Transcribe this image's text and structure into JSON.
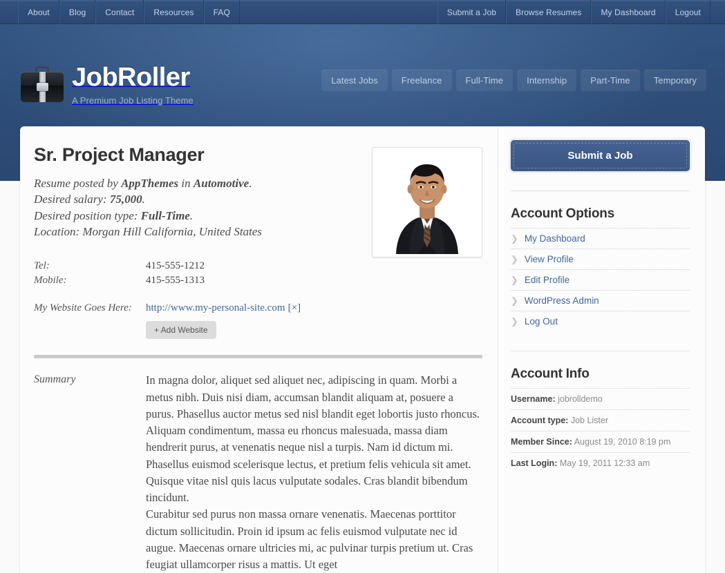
{
  "topbar": {
    "left_items": [
      {
        "label": "About"
      },
      {
        "label": "Blog"
      },
      {
        "label": "Contact"
      },
      {
        "label": "Resources"
      },
      {
        "label": "FAQ"
      }
    ],
    "right_items": [
      {
        "label": "Submit a Job"
      },
      {
        "label": "Browse Resumes"
      },
      {
        "label": "My Dashboard"
      },
      {
        "label": "Logout"
      }
    ]
  },
  "header": {
    "logo_icon": "briefcase-icon",
    "title": "JobRoller",
    "tagline": "A Premium Job Listing Theme",
    "categories": [
      {
        "label": "Latest Jobs"
      },
      {
        "label": "Freelance"
      },
      {
        "label": "Full-Time"
      },
      {
        "label": "Internship"
      },
      {
        "label": "Part-Time"
      },
      {
        "label": "Temporary"
      }
    ]
  },
  "resume": {
    "title": "Sr. Project Manager",
    "posted_prefix": "Resume posted by ",
    "posted_author": "AppThemes",
    "posted_middle": " in ",
    "posted_category": "Automotive",
    "posted_suffix": ".",
    "salary_label": "Desired salary: ",
    "salary_value": "75,000",
    "salary_suffix": ".",
    "position_label": "Desired position type: ",
    "position_value": "Full-Time",
    "position_suffix": ".",
    "location_line": "Location: Morgan Hill California, United States",
    "photo_alt": "applicant-photo",
    "contacts": [
      {
        "label": "Tel:",
        "value": "415-555-1212"
      },
      {
        "label": "Mobile:",
        "value": "415-555-1313"
      }
    ],
    "website_label": "My Website Goes Here:",
    "website_url": "http://www.my-personal-site.com",
    "website_remove": "[×]",
    "add_website_label": "+ Add Website",
    "summary_label": "Summary",
    "summary_paragraphs": [
      "In magna dolor, aliquet sed aliquet nec, adipiscing in quam. Morbi a metus nibh. Duis nisi diam, accumsan blandit aliquam at, posuere a purus. Phasellus auctor metus sed nisl blandit eget lobortis justo rhoncus. Aliquam condimentum, massa eu rhoncus malesuada, massa diam hendrerit purus, at venenatis neque nisl a turpis. Nam id dictum mi. Phasellus euismod scelerisque lectus, et pretium felis vehicula sit amet. Quisque vitae nisl quis lacus vulputate sodales. Cras blandit bibendum tincidunt.",
      "Curabitur sed purus non massa ornare venenatis. Maecenas porttitor dictum sollicitudin. Proin id ipsum ac felis euismod vulputate nec id augue. Maecenas ornare ultricies mi, ac pulvinar turpis pretium ut. Cras feugiat ullamcorper risus a mattis. Ut eget"
    ]
  },
  "sidebar": {
    "submit_job_label": "Submit a Job",
    "account_options_heading": "Account Options",
    "account_options": [
      {
        "label": "My Dashboard",
        "icon": "chevron-right-icon"
      },
      {
        "label": "View Profile",
        "icon": "chevron-right-icon"
      },
      {
        "label": "Edit Profile",
        "icon": "chevron-right-icon"
      },
      {
        "label": "WordPress Admin",
        "icon": "chevron-right-icon"
      },
      {
        "label": "Log Out",
        "icon": "chevron-right-icon"
      }
    ],
    "account_info_heading": "Account Info",
    "account_info": [
      {
        "label": "Username:",
        "value": " jobrolldemo"
      },
      {
        "label": "Account type:",
        "value": " Job Lister"
      },
      {
        "label": "Member Since:",
        "value": " August 19, 2010 8:19 pm"
      },
      {
        "label": "Last Login:",
        "value": " May 19, 2011 12:33 am"
      }
    ]
  },
  "colors": {
    "header_blue": "#2f5282",
    "topbar_blue": "#2d4d7d",
    "link_blue": "#41679b",
    "button_blue": "#3a5683"
  }
}
